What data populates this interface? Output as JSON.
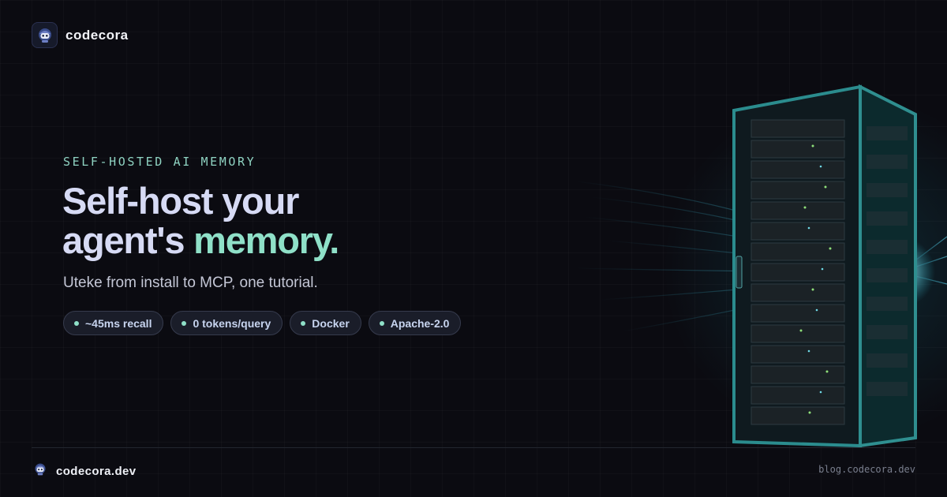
{
  "brand": {
    "name": "codecora",
    "logo_icon": "robot-mascot-icon"
  },
  "hero": {
    "eyebrow": "SELF-HOSTED AI MEMORY",
    "headline_line1": "Self-host your",
    "headline_line2_prefix": "agent's",
    "headline_line2_accent": "memory.",
    "subtitle": "Uteke from install to MCP, one tutorial."
  },
  "pills": [
    {
      "label": "~45ms recall"
    },
    {
      "label": "0 tokens/query"
    },
    {
      "label": "Docker"
    },
    {
      "label": "Apache-2.0"
    }
  ],
  "footer": {
    "brand": "codecora.dev",
    "url": "blog.codecora.dev",
    "logo_icon": "robot-mascot-icon"
  },
  "illustration": {
    "icon": "server-rack-icon"
  },
  "colors": {
    "background": "#0b0b11",
    "accent": "#8fe0c8",
    "headline": "#d6daf4",
    "teal_glow": "#1e96aa"
  }
}
